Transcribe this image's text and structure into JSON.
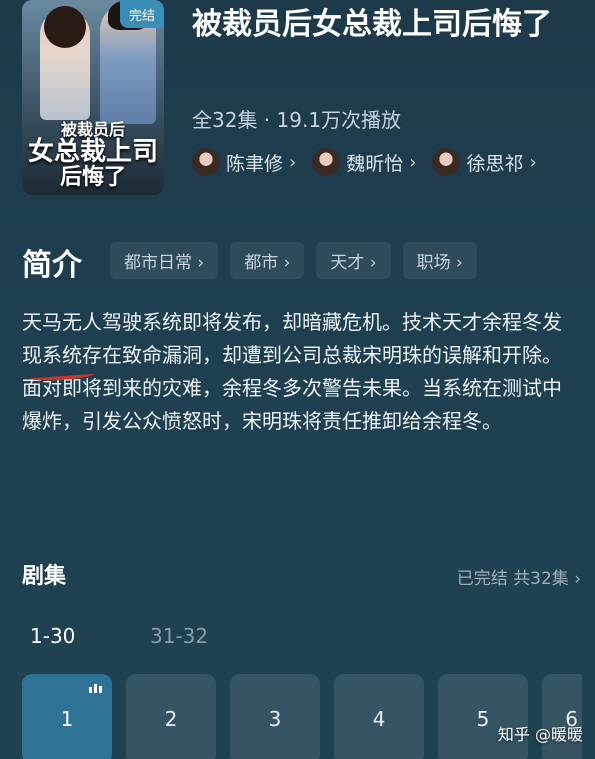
{
  "drama": {
    "title": "被裁员后女总裁上司后悔了",
    "status_badge": "完结",
    "poster_title": {
      "line1": "被裁员后",
      "line2": "女总裁上司",
      "line3": "后悔了"
    },
    "meta": "全32集 · 19.1万次播放",
    "cast": [
      {
        "name": "陈聿修"
      },
      {
        "name": "魏昕怡"
      },
      {
        "name": "徐思祁"
      }
    ]
  },
  "intro": {
    "label": "简介",
    "tags": [
      "都市日常 ›",
      "都市 ›",
      "天才 ›",
      "职场 ›"
    ],
    "description": "天马无人驾驶系统即将发布，却暗藏危机。技术天才余程冬发现系统存在致命漏洞，却遭到公司总裁宋明珠的误解和开除。面对即将到来的灾难，余程冬多次警告未果。当系统在测试中爆炸，引发公众愤怒时，宋明珠将责任推卸给余程冬。"
  },
  "episodes": {
    "label": "剧集",
    "status": "已完结 共32集 ›",
    "ranges": [
      "1-30",
      "31-32"
    ],
    "items": [
      "1",
      "2",
      "3",
      "4",
      "5",
      "6"
    ]
  },
  "watermark": "知乎 @暖暖",
  "colors": {
    "accent": "#2e7295",
    "badge": "#3a8fb8",
    "underline": "#c0392b"
  }
}
